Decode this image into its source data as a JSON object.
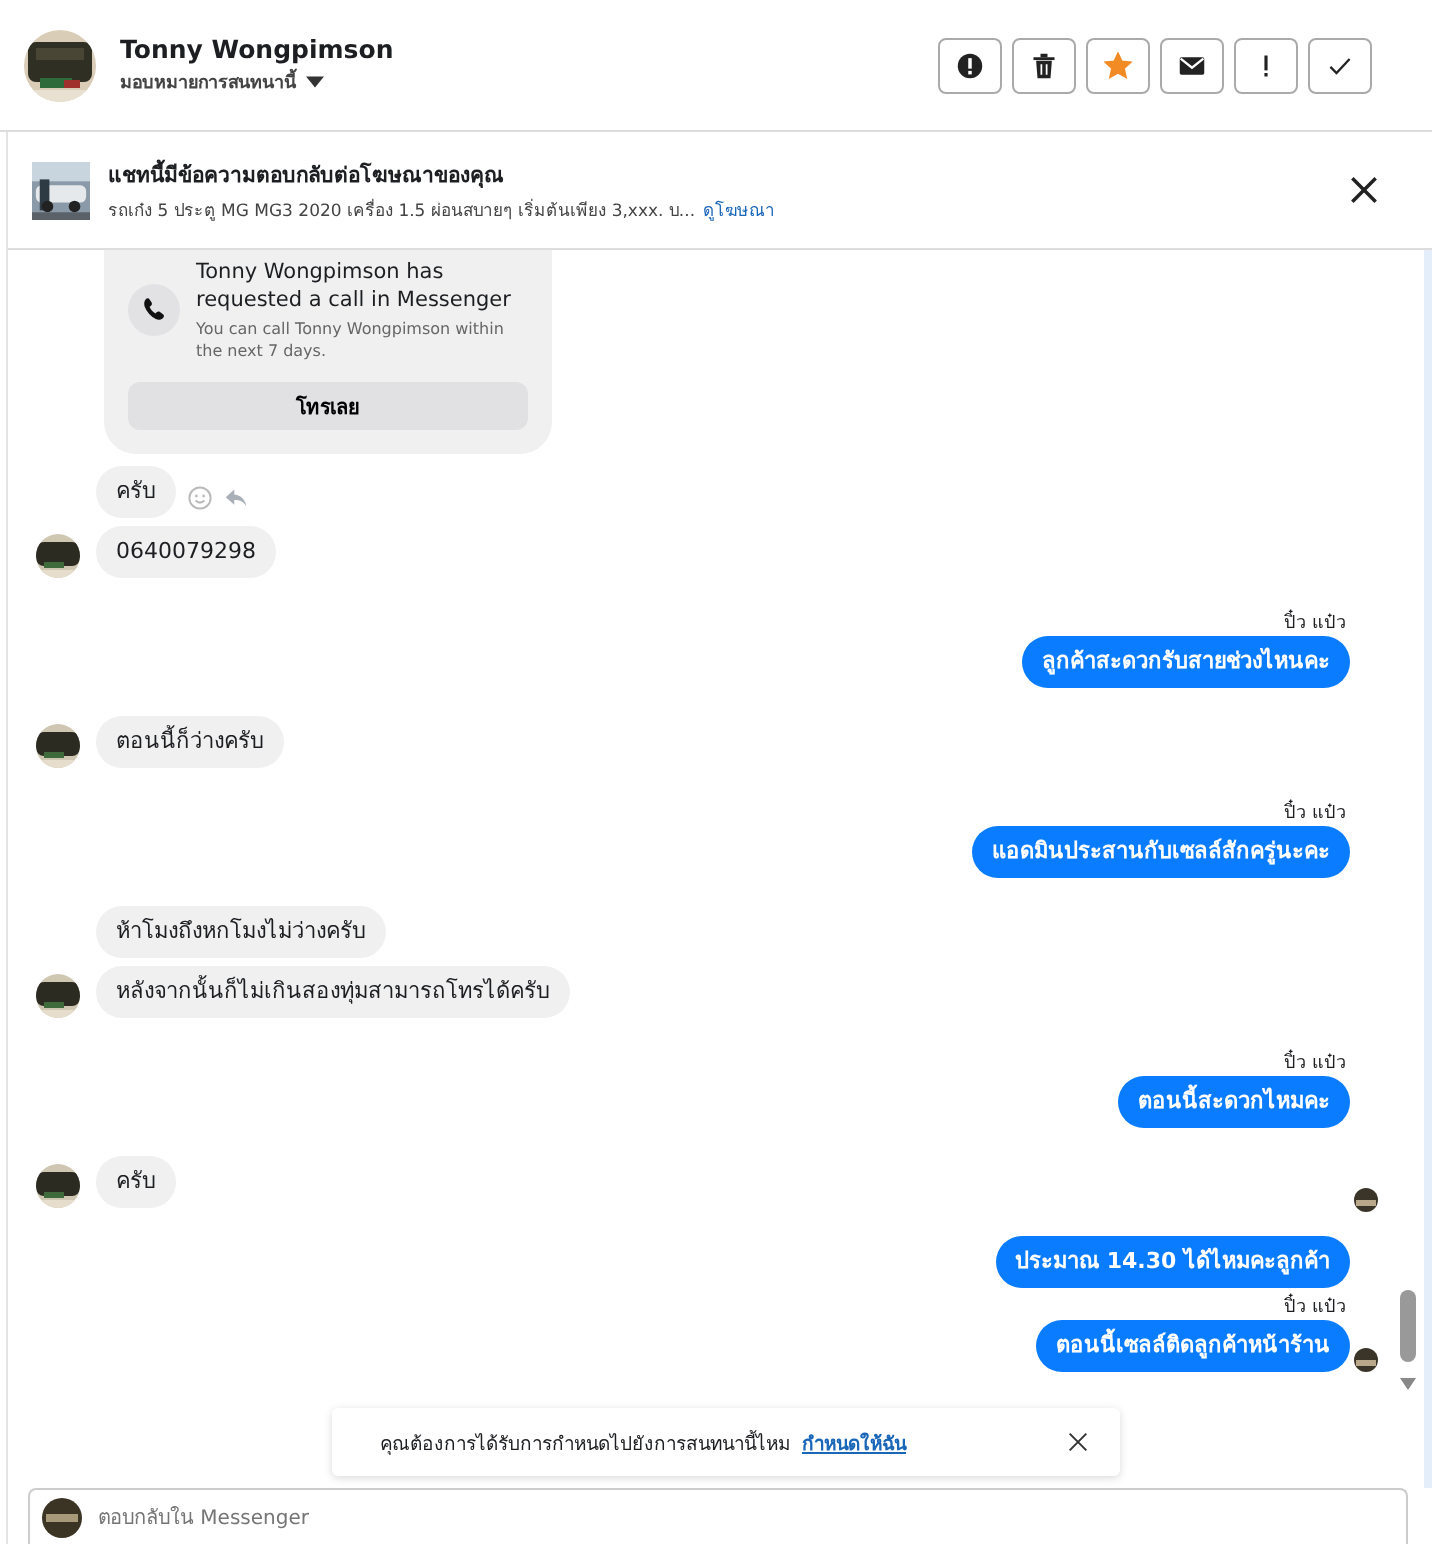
{
  "header": {
    "name": "Tonny Wongpimson",
    "assign_label": "มอบหมายการสนทนานี้",
    "starred": true
  },
  "ad_banner": {
    "title": "แชทนี้มีข้อความตอบกลับต่อโฆษณาของคุณ",
    "description": "รถเก๋ง 5 ประตู MG MG3 2020 เครื่อง 1.5 ผ่อนสบายๆ เริ่มต้นเพียง 3,xxx. บ...",
    "link": "ดูโฆษณา"
  },
  "messages": [
    {
      "kind": "call_card",
      "title": "Tonny Wongpimson has requested a call in Messenger",
      "subtitle": "You can call Tonny Wongpimson within the next 7 days.",
      "button": "โทรเลย"
    },
    {
      "kind": "incoming",
      "text": "ครับ",
      "avatar": false,
      "reactions": true
    },
    {
      "kind": "incoming",
      "text": "0640079298",
      "avatar": true,
      "reactions": false
    },
    {
      "kind": "outgoing",
      "sender": "ปิ๋ว แป๋ว",
      "text": "ลูกค้าสะดวกรับสายช่วงไหนคะ",
      "seen": false
    },
    {
      "kind": "incoming",
      "text": "ตอนนี้ก็ว่างครับ",
      "avatar": true,
      "reactions": false
    },
    {
      "kind": "outgoing",
      "sender": "ปิ๋ว แป๋ว",
      "text": "แอดมินประสานกับเซลล์สักครู่นะคะ",
      "seen": false
    },
    {
      "kind": "incoming",
      "text": "ห้าโมงถึงหกโมงไม่ว่างครับ",
      "avatar": false,
      "reactions": false
    },
    {
      "kind": "incoming",
      "text": "หลังจากนั้นก็ไม่เกินสองทุ่มสามารถโทรได้ครับ",
      "avatar": true,
      "reactions": false
    },
    {
      "kind": "outgoing",
      "sender": "ปิ๋ว แป๋ว",
      "text": "ตอนนี้สะดวกไหมคะ",
      "seen": false
    },
    {
      "kind": "incoming",
      "text": "ครับ",
      "avatar": true,
      "reactions": false
    },
    {
      "kind": "read_receipt"
    },
    {
      "kind": "outgoing",
      "text": "ประมาณ 14.30 ได้ไหมคะลูกค้า",
      "seen": false
    },
    {
      "kind": "outgoing",
      "sender": "ปิ๋ว แป๋ว",
      "text": "ตอนนี้เซลล์ติดลูกค้าหน้าร้าน",
      "seen": true
    }
  ],
  "toast": {
    "text": "คุณต้องการได้รับการกำหนดไปยังการสนทนานี้ไหม",
    "link": "กำหนดให้ฉัน"
  },
  "composer": {
    "placeholder": "ตอบกลับใน Messenger"
  }
}
